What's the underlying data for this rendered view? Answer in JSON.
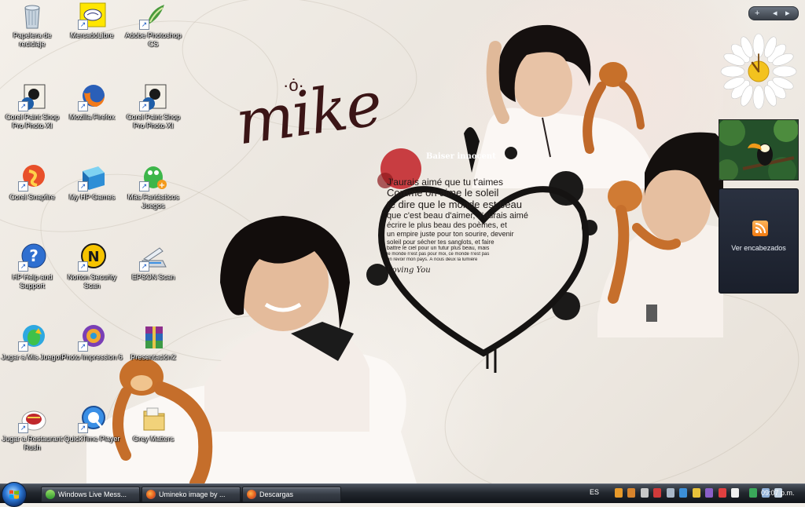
{
  "desktop_icons": [
    {
      "label": "Papelera de reciclaje",
      "icon": "recycle-bin-icon"
    },
    {
      "label": "MercadoLibre",
      "icon": "mercadolibre-icon"
    },
    {
      "label": "Adobe Photoshop CS",
      "icon": "photoshop-icon"
    },
    {
      "label": "Corel Paint Shop Pro Photo XI",
      "icon": "paintshop-icon"
    },
    {
      "label": "Mozilla Firefox",
      "icon": "firefox-icon"
    },
    {
      "label": "Corel Paint Shop Pro Photo XI",
      "icon": "paintshop-icon"
    },
    {
      "label": "Corel Snapfire",
      "icon": "snapfire-icon"
    },
    {
      "label": "My HP Games",
      "icon": "hp-games-icon"
    },
    {
      "label": "Más Fantásticos Juegos",
      "icon": "games-icon"
    },
    {
      "label": "HP Help and Support",
      "icon": "help-icon"
    },
    {
      "label": "Norton Security Scan",
      "icon": "norton-icon"
    },
    {
      "label": "EPSON Scan",
      "icon": "scanner-icon"
    },
    {
      "label": "Jugar a Mis Juegos",
      "icon": "play-games-icon"
    },
    {
      "label": "Photo Impression 6",
      "icon": "photo-impression-icon"
    },
    {
      "label": "Presentación2",
      "icon": "winrar-archive-icon"
    },
    {
      "label": "Jugar a Restaurant Rush",
      "icon": "restaurant-rush-icon"
    },
    {
      "label": "QuickTime Player",
      "icon": "quicktime-icon"
    },
    {
      "label": "Grey Matters",
      "icon": "folder-icon"
    }
  ],
  "wallpaper": {
    "name": "mike",
    "poem_lines": [
      "Baiser innocent",
      "J'aurais aimé que tu t'aimes",
      "Comme on aime le soleil",
      "te dire que le monde est beau",
      "que c'est beau d'aimer, J'aurais aimé",
      "écrire le plus beau des poèmes, et",
      "un empire juste pour ton sourire, devenir",
      "soleil pour sécher tes sanglots, et faire",
      "battre le ciel pour un futur plus beau, mais",
      "le monde n'est pas pour moi, ce monde n'est pas",
      "un revoir mon pays. À nous deux la lumière",
      "Loving You"
    ]
  },
  "gadgets": {
    "controls": [
      "+",
      "◂",
      "▸"
    ],
    "feeds_label": "Ver encabezados"
  },
  "taskbar": {
    "tasks": [
      {
        "label": "Windows Live Mess...",
        "icon": "msn-icon"
      },
      {
        "label": "Umineko image by ...",
        "icon": "firefox-icon"
      },
      {
        "label": "Descargas",
        "icon": "firefox-icon"
      }
    ],
    "language": "ES",
    "time": "09:07 p.m."
  },
  "colors": {
    "taskbar": "#23282f",
    "accent": "#2d79d6",
    "icon_label": "#ffffff"
  }
}
